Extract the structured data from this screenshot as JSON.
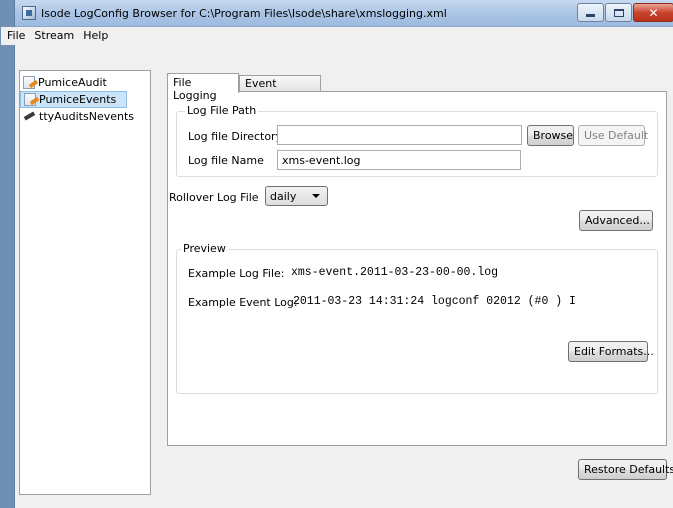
{
  "window": {
    "title": "Isode LogConfig Browser for C:\\Program Files\\Isode\\share\\xmslogging.xml",
    "close_glyph": "✕"
  },
  "menu": [
    "File",
    "Stream",
    "Help"
  ],
  "tree": {
    "items": [
      {
        "label": "PumiceAudit",
        "icon": "document-pen-icon",
        "selected": false
      },
      {
        "label": "PumiceEvents",
        "icon": "document-pen-icon",
        "selected": true
      },
      {
        "label": "ttyAuditsNevents",
        "icon": "pen-icon",
        "selected": false
      }
    ]
  },
  "tabs": {
    "file_logging": "File Logging",
    "event_logging": "Event Logging"
  },
  "log_file_path": {
    "group_label": "Log File Path",
    "directory_label": "Log file Directory",
    "directory_value": "",
    "browse_label": "Browse",
    "use_default_label": "Use Default",
    "name_label": "Log file Name",
    "name_value": "xms-event.log"
  },
  "rollover": {
    "label": "Rollover Log File",
    "value": "daily"
  },
  "advanced_label": "Advanced...",
  "preview": {
    "group_label": "Preview",
    "example_log_file_label": "Example Log File:",
    "example_log_file_value": "xms-event.2011-03-23-00-00.log",
    "example_event_log_label": "Example Event Log:",
    "example_event_log_value": "2011-03-23 14:31:24 logconf  02012 (#0       ) I",
    "edit_formats_label": "Edit Formats..."
  },
  "restore_defaults_label": "Restore Defaults"
}
